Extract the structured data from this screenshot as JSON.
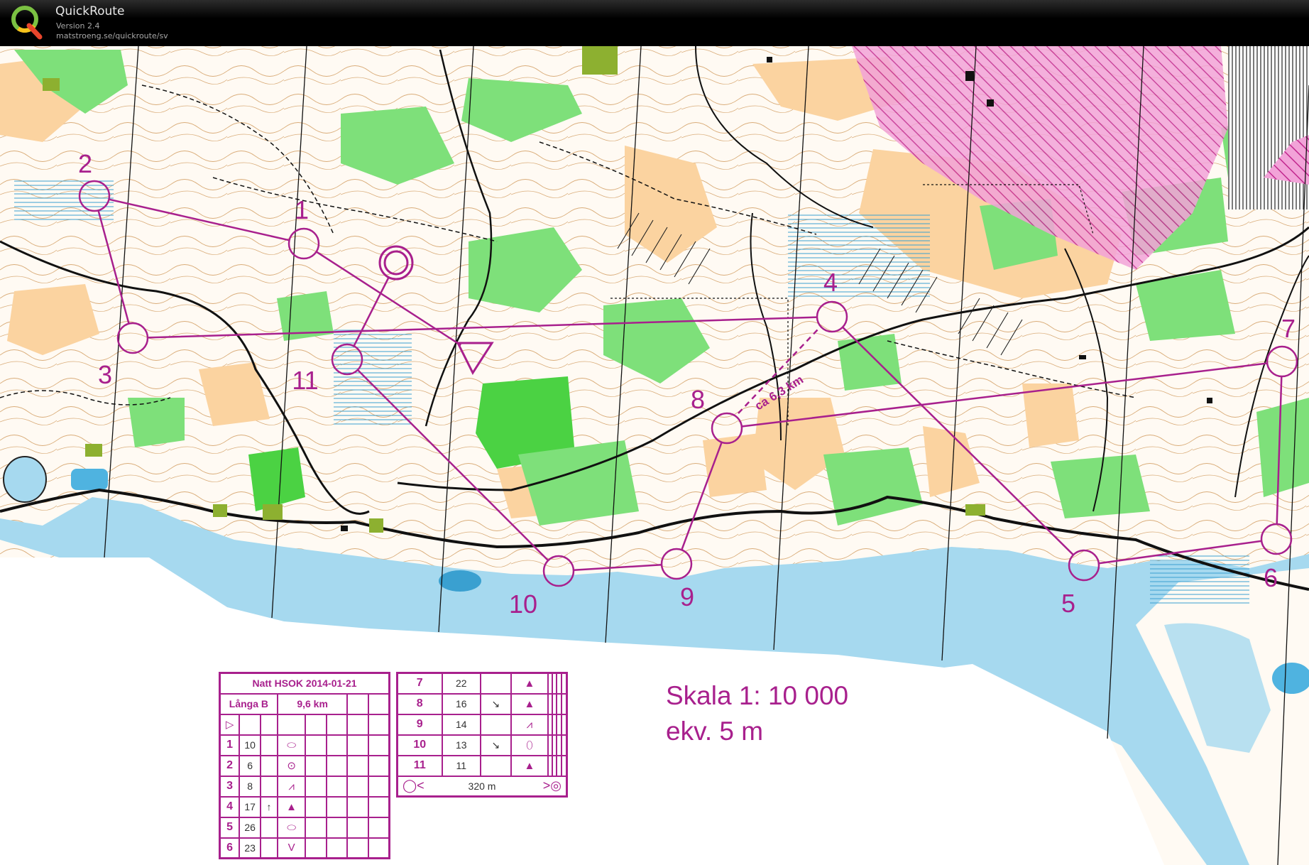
{
  "app": {
    "title": "QuickRoute",
    "version": "Version 2.4",
    "url": "matstroeng.se/quickroute/sv"
  },
  "map": {
    "course_color": "#a8208d",
    "water_color": "#a6d9ef",
    "forest_color": "#7ee07a",
    "open_land_color": "#fbd3a0",
    "contour_color": "#b5651d",
    "controls": [
      {
        "label": "1"
      },
      {
        "label": "2"
      },
      {
        "label": "3"
      },
      {
        "label": "4"
      },
      {
        "label": "5"
      },
      {
        "label": "6"
      },
      {
        "label": "7"
      },
      {
        "label": "8"
      },
      {
        "label": "9"
      },
      {
        "label": "10"
      },
      {
        "label": "11"
      }
    ],
    "leg_note": "ca 6,3 km",
    "scale_line1": "Skala 1: 10 000",
    "scale_line2": "ekv. 5 m"
  },
  "control_descriptions": {
    "title": "Natt HSOK 2014-01-21",
    "course_name": "Långa B",
    "course_length": "9,6 km",
    "start_symbol": "▷",
    "finish_distance": "320 m",
    "rows": [
      {
        "num": "1",
        "code": "10",
        "dir": "",
        "feature": "⬭"
      },
      {
        "num": "2",
        "code": "6",
        "dir": "",
        "feature": "⊙"
      },
      {
        "num": "3",
        "code": "8",
        "dir": "",
        "feature": "⩘"
      },
      {
        "num": "4",
        "code": "17",
        "dir": "↑",
        "feature": "▲"
      },
      {
        "num": "5",
        "code": "26",
        "dir": "",
        "feature": "⬭"
      },
      {
        "num": "6",
        "code": "23",
        "dir": "",
        "feature": "V"
      },
      {
        "num": "7",
        "code": "22",
        "dir": "",
        "feature": "▲"
      },
      {
        "num": "8",
        "code": "16",
        "dir": "↘",
        "feature": "▲"
      },
      {
        "num": "9",
        "code": "14",
        "dir": "",
        "feature": "⩘"
      },
      {
        "num": "10",
        "code": "13",
        "dir": "↘",
        "feature": "⬯"
      },
      {
        "num": "11",
        "code": "11",
        "dir": "",
        "feature": "▲"
      }
    ]
  }
}
